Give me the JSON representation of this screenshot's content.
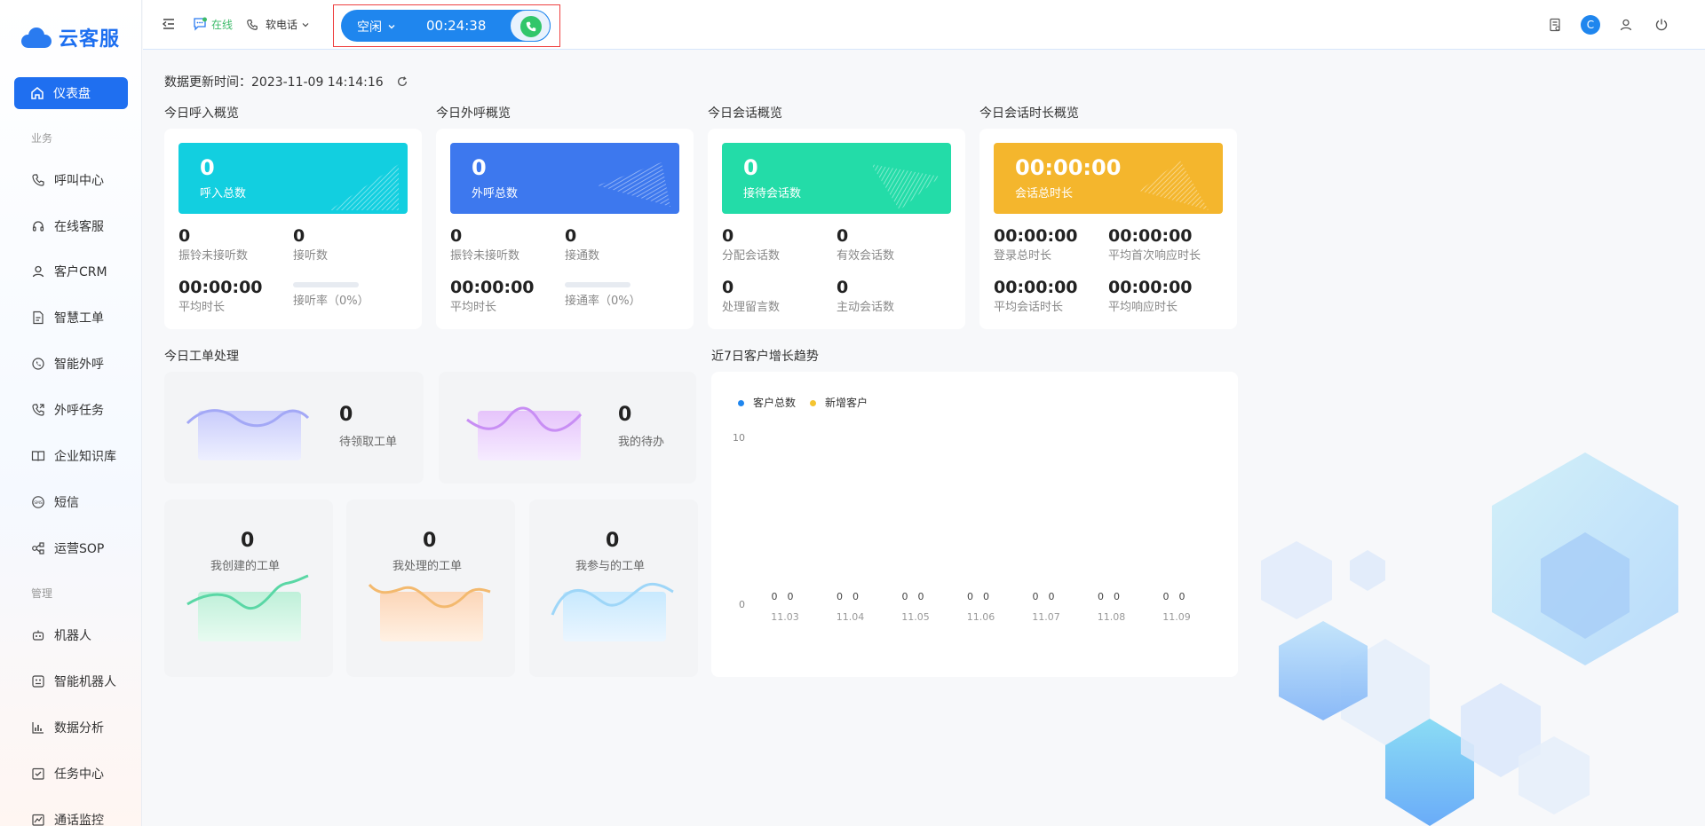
{
  "app": {
    "name": "云客服"
  },
  "sidebar": {
    "active": {
      "label": "仪表盘",
      "icon": "home-icon"
    },
    "section_business": "业务",
    "section_manage": "管理",
    "items": [
      {
        "label": "呼叫中心",
        "icon": "phone-icon"
      },
      {
        "label": "在线客服",
        "icon": "headset-icon"
      },
      {
        "label": "客户CRM",
        "icon": "user-icon"
      },
      {
        "label": "智慧工单",
        "icon": "document-icon"
      },
      {
        "label": "智能外呼",
        "icon": "whatsapp-icon"
      },
      {
        "label": "外呼任务",
        "icon": "phone-out-icon"
      },
      {
        "label": "企业知识库",
        "icon": "book-icon"
      },
      {
        "label": "短信",
        "icon": "sms-icon"
      },
      {
        "label": "运营SOP",
        "icon": "flow-icon"
      },
      {
        "label": "机器人",
        "icon": "robot-icon"
      },
      {
        "label": "智能机器人",
        "icon": "smart-robot-icon"
      },
      {
        "label": "数据分析",
        "icon": "bar-chart-icon"
      },
      {
        "label": "任务中心",
        "icon": "checklist-icon"
      },
      {
        "label": "通话监控",
        "icon": "monitor-chart-icon"
      }
    ]
  },
  "header": {
    "online_status": "在线",
    "phone_type": "软电话",
    "call_status": "空闲",
    "call_timer": "00:24:38",
    "avatar_letter": "C"
  },
  "main": {
    "update_label": "数据更新时间：",
    "update_time": "2023-11-09 14:14:16",
    "inbound": {
      "title": "今日呼入概览",
      "banner_value": "0",
      "banner_label": "呼入总数",
      "stats": [
        {
          "value": "0",
          "label": "振铃未接听数"
        },
        {
          "value": "0",
          "label": "接听数"
        },
        {
          "value": "00:00:00",
          "label": "平均时长"
        }
      ],
      "rate_label": "接听率（0%）",
      "color": "#12cfe0"
    },
    "outbound": {
      "title": "今日外呼概览",
      "banner_value": "0",
      "banner_label": "外呼总数",
      "stats": [
        {
          "value": "0",
          "label": "振铃未接听数"
        },
        {
          "value": "0",
          "label": "接通数"
        },
        {
          "value": "00:00:00",
          "label": "平均时长"
        }
      ],
      "rate_label": "接通率（0%）",
      "color": "#3d78ee"
    },
    "session": {
      "title": "今日会话概览",
      "banner_value": "0",
      "banner_label": "接待会话数",
      "stats": [
        {
          "value": "0",
          "label": "分配会话数"
        },
        {
          "value": "0",
          "label": "有效会话数"
        },
        {
          "value": "0",
          "label": "处理留言数"
        },
        {
          "value": "0",
          "label": "主动会话数"
        }
      ],
      "color": "#23dca8"
    },
    "duration": {
      "title": "今日会话时长概览",
      "banner_value": "00:00:00",
      "banner_label": "会话总时长",
      "stats": [
        {
          "value": "00:00:00",
          "label": "登录总时长"
        },
        {
          "value": "00:00:00",
          "label": "平均首次响应时长"
        },
        {
          "value": "00:00:00",
          "label": "平均会话时长"
        },
        {
          "value": "00:00:00",
          "label": "平均响应时长"
        }
      ],
      "color": "#f4b62d"
    },
    "workorder": {
      "title": "今日工单处理",
      "cards": [
        {
          "value": "0",
          "label": "待领取工单"
        },
        {
          "value": "0",
          "label": "我的待办"
        },
        {
          "value": "0",
          "label": "我创建的工单"
        },
        {
          "value": "0",
          "label": "我处理的工单"
        },
        {
          "value": "0",
          "label": "我参与的工单"
        }
      ]
    },
    "trend": {
      "title": "近7日客户增长趋势"
    }
  },
  "chart_data": {
    "type": "bar",
    "categories": [
      "11.03",
      "11.04",
      "11.05",
      "11.06",
      "11.07",
      "11.08",
      "11.09"
    ],
    "series": [
      {
        "name": "客户总数",
        "values": [
          0,
          0,
          0,
          0,
          0,
          0,
          0
        ],
        "color": "#1f86ee"
      },
      {
        "name": "新增客户",
        "values": [
          0,
          0,
          0,
          0,
          0,
          0,
          0
        ],
        "color": "#f4c430"
      }
    ],
    "y_ticks": [
      "10",
      "0"
    ],
    "ylim": [
      0,
      10
    ],
    "legend": "top-left"
  }
}
